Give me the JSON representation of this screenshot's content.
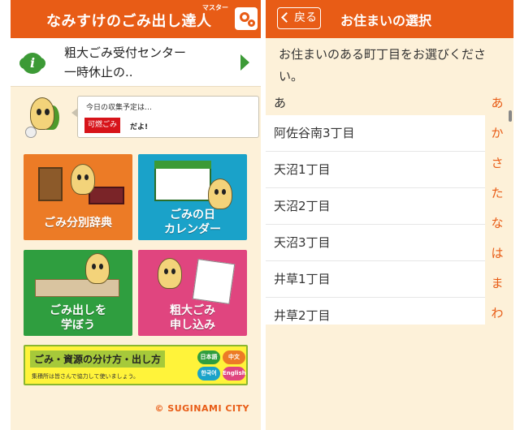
{
  "left": {
    "app_title": "なみすけのごみ出し達人",
    "title_ruby": "マスター",
    "notice": {
      "text": "粗大ごみ受付センター\n一時休止の.."
    },
    "today": {
      "label": "今日の収集予定は…",
      "badge": "可燃ごみ",
      "suffix": "だよ!"
    },
    "tiles": [
      {
        "label": "ごみ分別辞典"
      },
      {
        "label": "ごみの日\nカレンダー"
      },
      {
        "label": "ごみ出しを\n学ぼう"
      },
      {
        "label": "粗大ごみ\n申し込み"
      }
    ],
    "banner": {
      "title": "ごみ・資源の分け方・出し方",
      "subtitle": "集積所は皆さんで協力して使いましょう。",
      "languages": [
        "日本語",
        "中文",
        "한국어",
        "English"
      ]
    },
    "footer": "© SUGINAMI CITY"
  },
  "right": {
    "back_label": "戻る",
    "title": "お住まいの選択",
    "prompt": "お住まいのある町丁目をお選びください。",
    "section_header": "あ",
    "items": [
      "阿佐谷南3丁目",
      "天沼1丁目",
      "天沼2丁目",
      "天沼3丁目",
      "井草1丁目",
      "井草2丁目"
    ],
    "index": [
      "あ",
      "か",
      "さ",
      "た",
      "な",
      "は",
      "ま",
      "わ"
    ]
  },
  "colors": {
    "brand_orange": "#e85c16",
    "cream": "#fdf1d9",
    "green": "#3c9a36",
    "burnable_red": "#d7141a"
  }
}
